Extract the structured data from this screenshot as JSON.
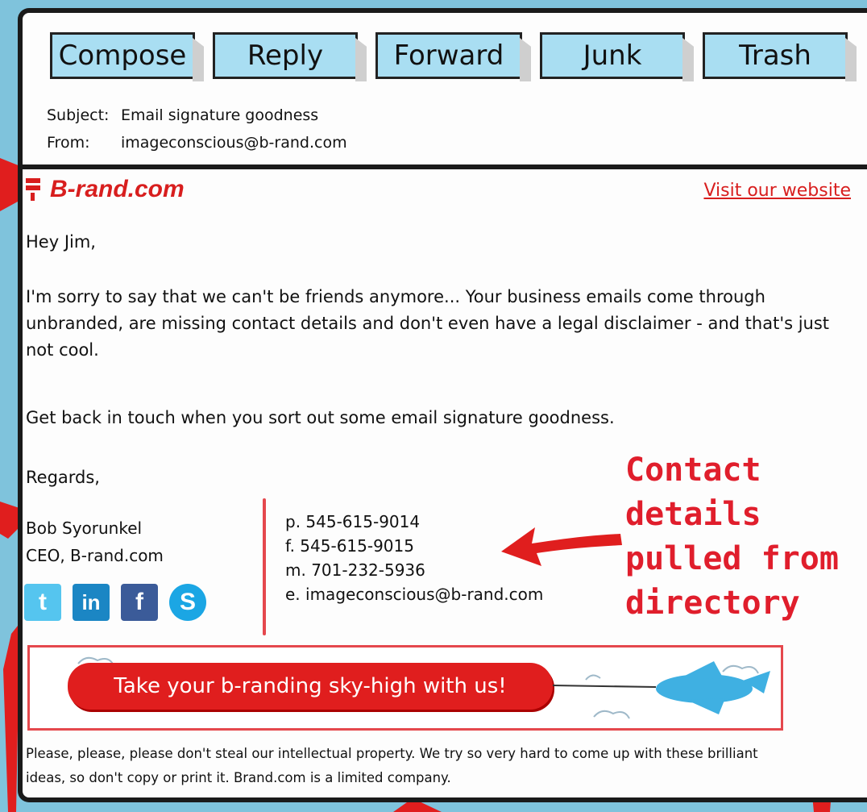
{
  "toolbar": {
    "compose": "Compose",
    "reply": "Reply",
    "forward": "Forward",
    "junk": "Junk",
    "trash": "Trash"
  },
  "email": {
    "subject_label": "Subject:",
    "subject": "Email signature goodness",
    "from_label": "From:",
    "from": "imageconscious@b-rand.com"
  },
  "brand": {
    "name": "B-rand.com",
    "visit_link": "Visit our website",
    "color": "#d81e1e"
  },
  "message": {
    "greeting": "Hey Jim,",
    "paragraph1": "I'm sorry to say that we can't be friends anymore... Your business emails come through unbranded, are missing contact details and don't even have a legal disclaimer - and that's just not cool.",
    "paragraph2": "Get back in touch when you sort out some email signature goodness.",
    "closing": "Regards,"
  },
  "signature": {
    "name": "Bob Syorunkel",
    "title": "CEO, B-rand.com",
    "phone": "p. 545-615-9014",
    "fax": "f. 545-615-9015",
    "mobile": "m. 701-232-5936",
    "email": "e. imageconscious@b-rand.com"
  },
  "social": {
    "twitter": "twitter-icon",
    "linkedin": "linkedin-icon",
    "facebook": "facebook-icon",
    "skype": "skype-icon"
  },
  "annotation": {
    "text": "Contact details pulled from directory",
    "color": "#e01e2c"
  },
  "banner": {
    "text": "Take your b-randing sky-high with us!"
  },
  "disclaimer": {
    "text": "Please, please, please don't steal our intellectual property. We try so very hard to come up with these brilliant ideas, so don't copy or print it. Brand.com is a limited company."
  }
}
